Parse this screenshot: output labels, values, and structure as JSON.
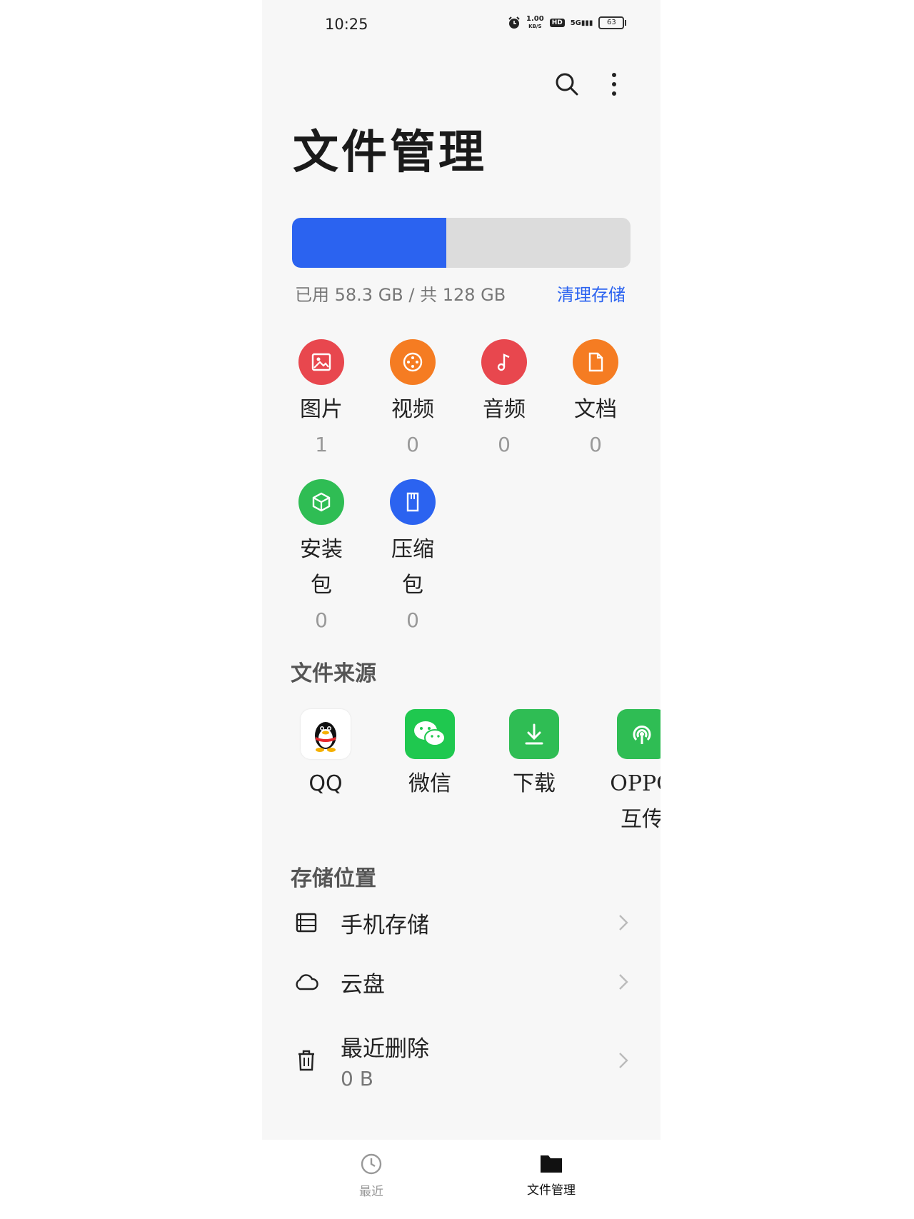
{
  "status": {
    "time": "10:25",
    "speed_top": "1.00",
    "speed_unit": "KB/S",
    "hd": "HD",
    "network": "5G",
    "battery": "63"
  },
  "header": {
    "title": "文件管理"
  },
  "storage": {
    "used_fraction": 0.4555,
    "usage_text": "已用 58.3 GB / 共 128 GB",
    "clean_label": "清理存储",
    "fill_color": "#2b63f0"
  },
  "categories": [
    {
      "label": "图片",
      "count": "1",
      "color": "#e8474e",
      "icon": "image-icon"
    },
    {
      "label": "视频",
      "count": "0",
      "color": "#f57c22",
      "icon": "video-icon"
    },
    {
      "label": "音频",
      "count": "0",
      "color": "#e8474e",
      "icon": "music-icon"
    },
    {
      "label": "文档",
      "count": "0",
      "color": "#f57c22",
      "icon": "document-icon"
    },
    {
      "label": "安装包",
      "count": "0",
      "color": "#2fbd54",
      "icon": "package-icon"
    },
    {
      "label": "压缩包",
      "count": "0",
      "color": "#2b63f0",
      "icon": "archive-icon"
    }
  ],
  "sources": {
    "heading": "文件来源",
    "items": [
      {
        "label": "QQ",
        "icon": "qq-icon",
        "color": "#ffffff"
      },
      {
        "label": "微信",
        "icon": "wechat-icon",
        "color": "#1fc84f"
      },
      {
        "label": "下载",
        "icon": "download-icon",
        "color": "#2fbd54"
      },
      {
        "label": "OPPO互传",
        "icon": "oppo-share-icon",
        "color": "#2fbd54"
      }
    ]
  },
  "locations": {
    "heading": "存储位置",
    "items": [
      {
        "label": "手机存储",
        "sub": "",
        "icon": "phone-storage-icon"
      },
      {
        "label": "云盘",
        "sub": "",
        "icon": "cloud-icon"
      },
      {
        "label": "最近删除",
        "sub": "0 B",
        "icon": "trash-icon"
      }
    ]
  },
  "tabs": [
    {
      "label": "最近",
      "icon": "clock-icon",
      "active": false
    },
    {
      "label": "文件管理",
      "icon": "folder-icon",
      "active": true
    }
  ]
}
